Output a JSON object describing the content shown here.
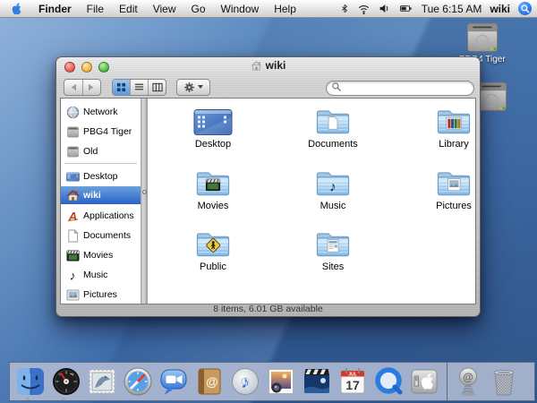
{
  "menu_bar": {
    "menus": [
      {
        "label": "Finder"
      },
      {
        "label": "File"
      },
      {
        "label": "Edit"
      },
      {
        "label": "View"
      },
      {
        "label": "Go"
      },
      {
        "label": "Window"
      },
      {
        "label": "Help"
      }
    ],
    "clock": "Tue 6:15 AM",
    "user": "wiki",
    "status_icons": [
      "bluetooth-icon",
      "airport-icon",
      "volume-icon",
      "battery-icon",
      "spotlight-icon"
    ]
  },
  "desktop": {
    "volumes": [
      {
        "label": "PBG4 Tiger",
        "icon": "hard-drive-icon"
      },
      {
        "label": "",
        "icon": "hard-drive-icon"
      }
    ]
  },
  "window": {
    "title": "wiki",
    "toolbar": {
      "search_value": "",
      "view_modes": [
        "icon",
        "list",
        "column"
      ],
      "selected_view": "icon"
    },
    "sidebar": {
      "items": [
        {
          "label": "Network",
          "icon": "network-globe-icon"
        },
        {
          "label": "PBG4 Tiger",
          "icon": "hard-drive-icon"
        },
        {
          "label": "Old",
          "icon": "hard-drive-icon"
        },
        {
          "label": "Desktop",
          "icon": "desktop-icon"
        },
        {
          "label": "wiki",
          "icon": "home-icon",
          "selected": true
        },
        {
          "label": "Applications",
          "icon": "applications-icon"
        },
        {
          "label": "Documents",
          "icon": "document-icon"
        },
        {
          "label": "Movies",
          "icon": "movies-icon"
        },
        {
          "label": "Music",
          "icon": "music-icon"
        },
        {
          "label": "Pictures",
          "icon": "pictures-icon"
        }
      ]
    },
    "main": {
      "items": [
        {
          "label": "Desktop",
          "icon": "desktop-icon"
        },
        {
          "label": "Documents",
          "icon": "folder-documents-icon"
        },
        {
          "label": "Library",
          "icon": "folder-library-icon"
        },
        {
          "label": "Movies",
          "icon": "folder-movies-icon"
        },
        {
          "label": "Music",
          "icon": "folder-music-icon"
        },
        {
          "label": "Pictures",
          "icon": "folder-pictures-icon"
        },
        {
          "label": "Public",
          "icon": "folder-public-icon"
        },
        {
          "label": "Sites",
          "icon": "folder-sites-icon"
        }
      ]
    },
    "status_bar": "8 items, 6.01 GB available"
  },
  "dock": {
    "items": [
      "finder",
      "dashboard",
      "mail",
      "safari",
      "ichat",
      "address-book",
      "itunes",
      "iphoto",
      "imovie",
      "ical",
      "quicktime",
      "system-preferences"
    ],
    "right_items": [
      "mac-dot-com",
      "trash"
    ],
    "running": [
      "finder",
      "dashboard"
    ],
    "ical_day": "17",
    "ical_month": "JUL"
  },
  "glyphs": {
    "music_note": "♪",
    "applications_letter": "A",
    "at_sign": "@"
  },
  "colors": {
    "selection_blue": "#2a63c8",
    "desktop_blue": "#3f6fae",
    "dock_bg": "#b0bcd4"
  }
}
